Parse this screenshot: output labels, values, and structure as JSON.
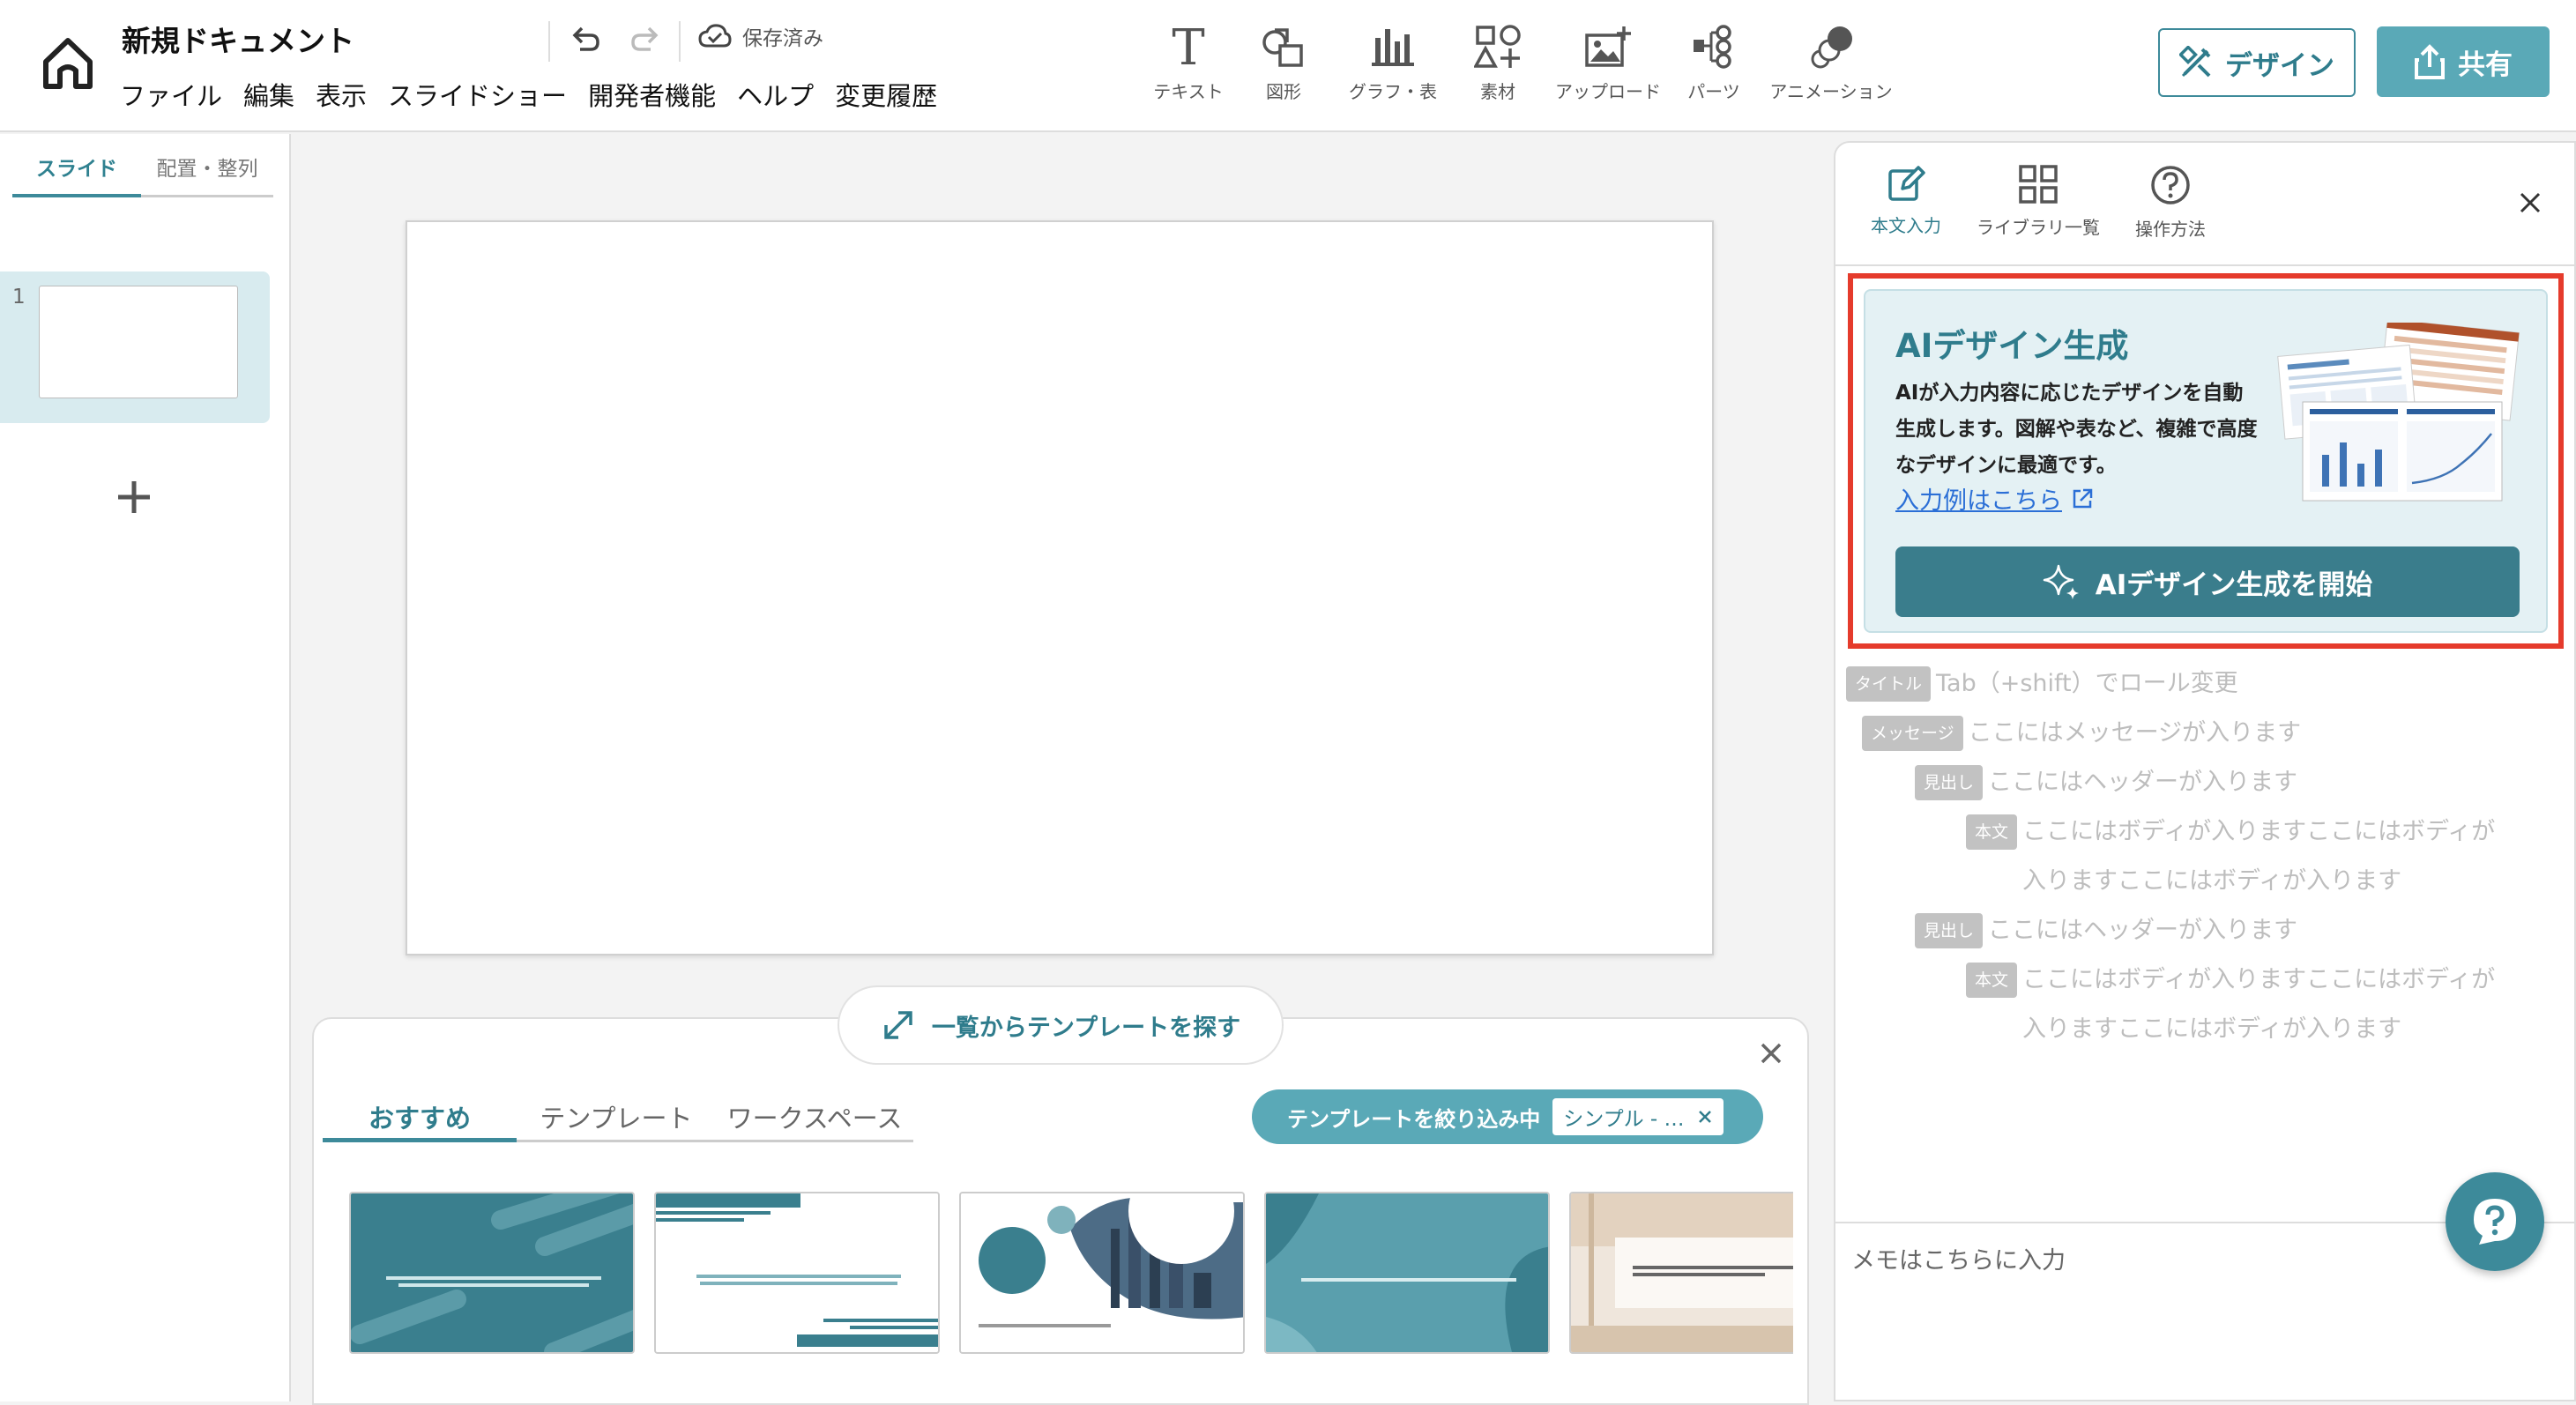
{
  "header": {
    "doc_title": "新規ドキュメント",
    "menu": [
      "ファイル",
      "編集",
      "表示",
      "スライドショー",
      "開発者機能",
      "ヘルプ",
      "変更履歴"
    ],
    "saved_status": "保存済み",
    "tools": [
      {
        "label": "テキスト",
        "icon": "text-icon"
      },
      {
        "label": "図形",
        "icon": "shapes-icon"
      },
      {
        "label": "グラフ・表",
        "icon": "chart-icon"
      },
      {
        "label": "素材",
        "icon": "assets-icon"
      },
      {
        "label": "アップロード",
        "icon": "upload-image-icon"
      },
      {
        "label": "パーツ",
        "icon": "parts-icon"
      },
      {
        "label": "アニメーション",
        "icon": "animation-icon"
      }
    ],
    "design_label": "デザイン",
    "share_label": "共有"
  },
  "left_panel": {
    "tabs": [
      "スライド",
      "配置・整列"
    ],
    "slides": [
      {
        "number": "1"
      }
    ]
  },
  "template_drawer": {
    "find_label": "一覧からテンプレートを探す",
    "tabs": [
      "おすすめ",
      "テンプレート",
      "ワークスペース"
    ],
    "filter_label": "テンプレートを絞り込み中",
    "filter_value": "シンプル - …"
  },
  "right_panel": {
    "tabs": [
      {
        "label": "本文入力",
        "icon": "edit-icon"
      },
      {
        "label": "ライブラリ一覧",
        "icon": "grid-icon"
      },
      {
        "label": "操作方法",
        "icon": "help-circle-icon"
      }
    ],
    "ai_card": {
      "title": "AIデザイン生成",
      "description": "AIが入力内容に応じたデザインを自動生成します。図解や表など、複雑で高度なデザインに最適です。",
      "link": "入力例はこちら",
      "button": "AIデザイン生成を開始"
    },
    "outline": [
      {
        "tag": "タイトル",
        "text": "Tab（+shift）でロール変更"
      },
      {
        "tag": "メッセージ",
        "text": "ここにはメッセージが入ります"
      },
      {
        "tag": "見出し",
        "text": "ここにはヘッダーが入ります"
      },
      {
        "tag": "本文",
        "text": "ここにはボディが入りますここにはボディが入りますここにはボディが入ります"
      },
      {
        "tag": "見出し",
        "text": "ここにはヘッダーが入ります"
      },
      {
        "tag": "本文",
        "text": "ここにはボディが入りますここにはボディが入りますここにはボディが入ります"
      }
    ],
    "memo_placeholder": "メモはこちらに入力"
  },
  "colors": {
    "accent": "#3d8a9a",
    "accent_light": "#5aa9b7",
    "highlight": "#e53b2c",
    "link": "#2b6fd6"
  }
}
